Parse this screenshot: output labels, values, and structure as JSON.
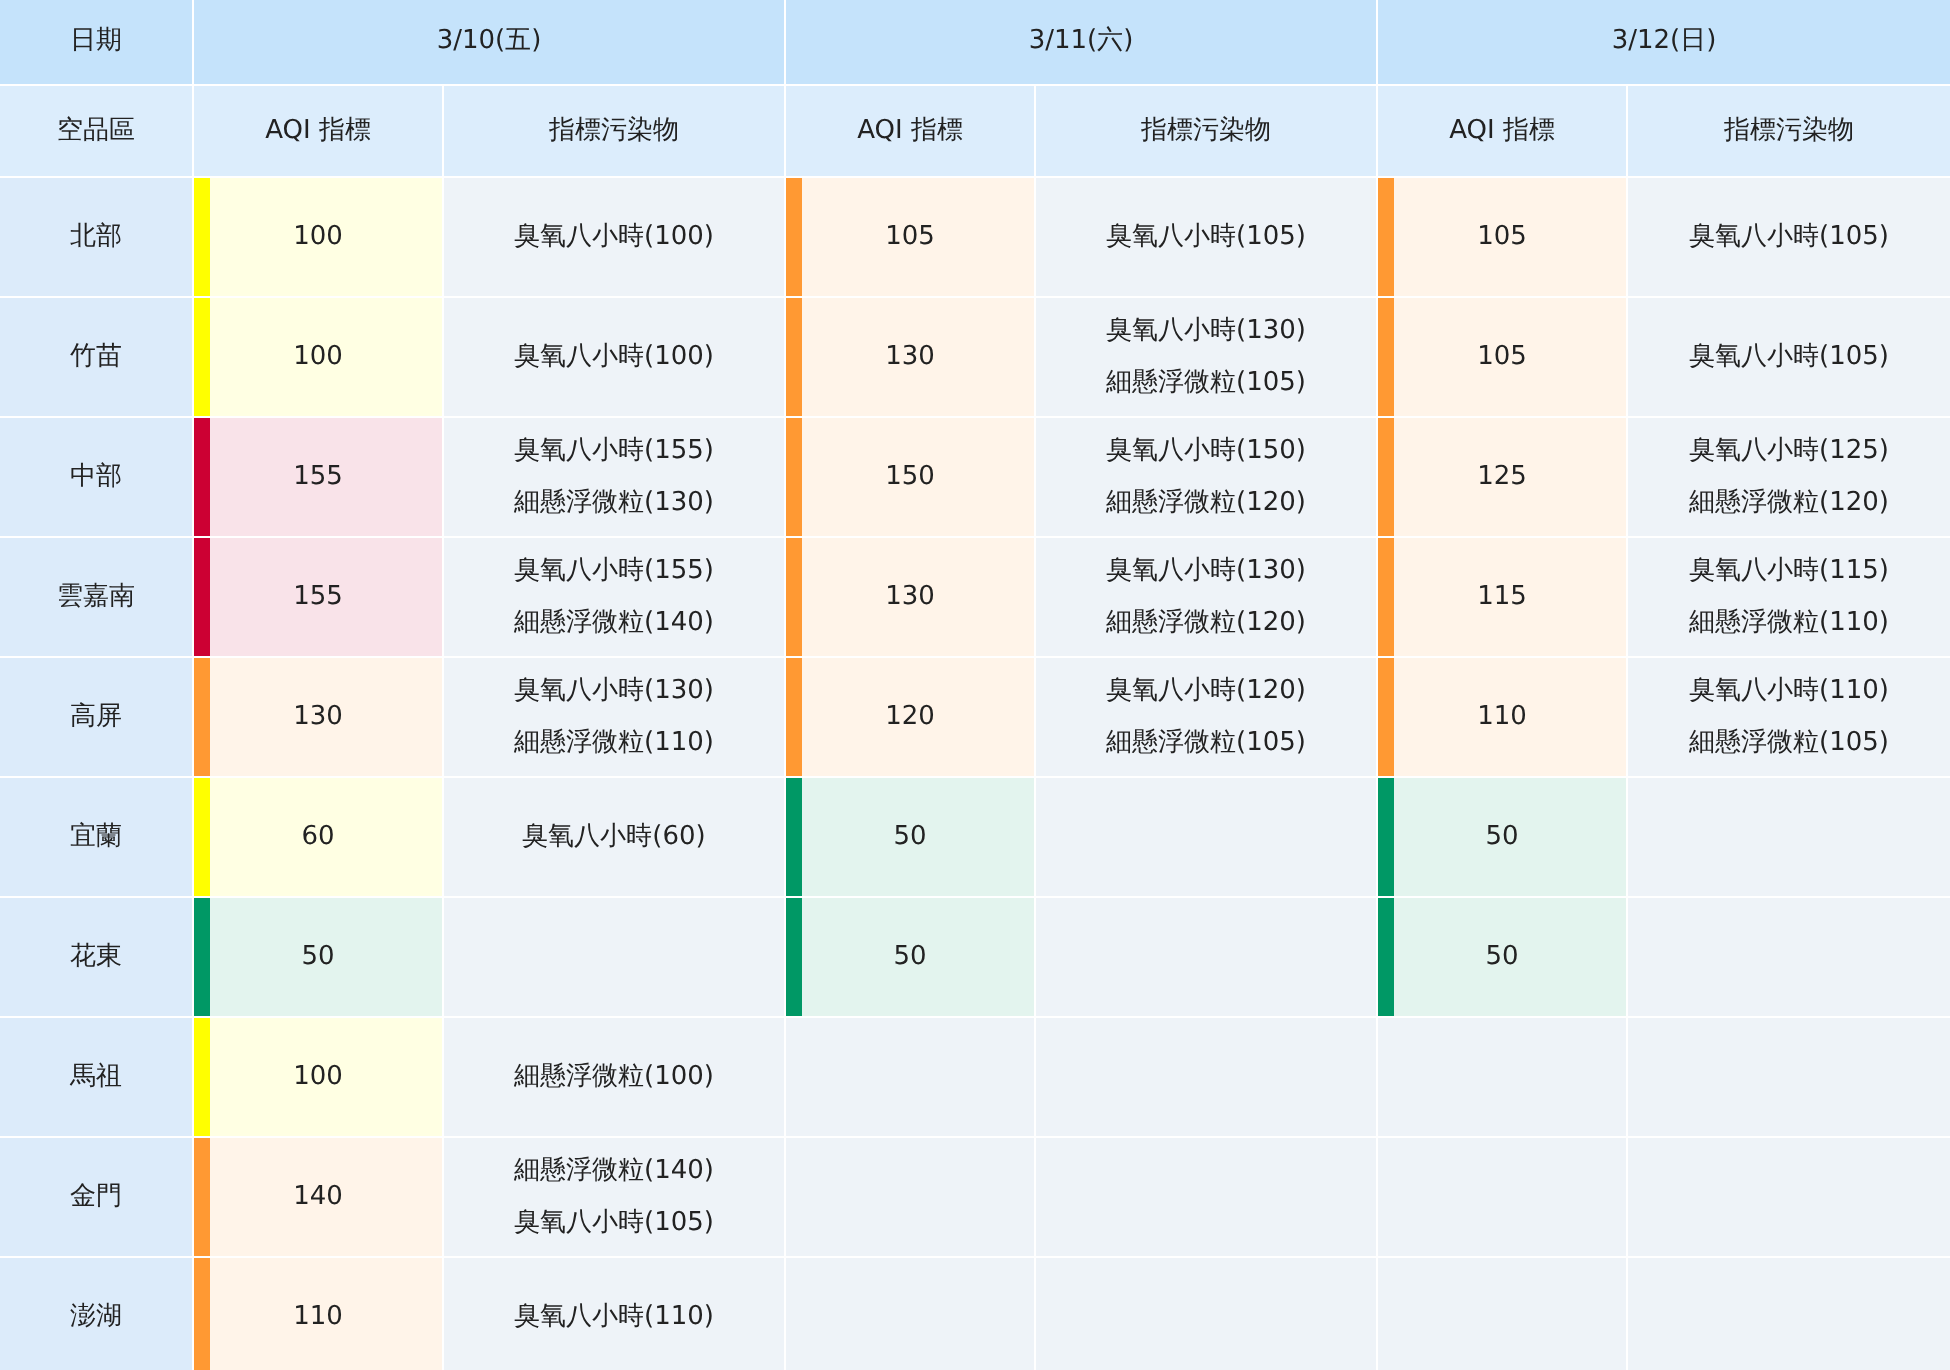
{
  "header": {
    "date_label": "日期",
    "dates": [
      "3/10(五)",
      "3/11(六)",
      "3/12(日)"
    ],
    "region_label": "空品區",
    "subheaders": [
      {
        "aqi_label": "AQI 指標",
        "pollutant_label": "指標污染物"
      },
      {
        "aqi_label": "AQI 指標",
        "pollutant_label": "指標污染物"
      },
      {
        "aqi_label": "AQI 指標",
        "pollutant_label": "指標污染物"
      }
    ]
  },
  "rows": [
    {
      "region": "北部",
      "days": [
        {
          "aqi": "100",
          "color": "#ffff00",
          "pollutants": [
            "臭氧八小時(100)"
          ]
        },
        {
          "aqi": "105",
          "color": "#ff9933",
          "pollutants": [
            "臭氧八小時(105)"
          ]
        },
        {
          "aqi": "105",
          "color": "#ff9933",
          "pollutants": [
            "臭氧八小時(105)"
          ]
        }
      ]
    },
    {
      "region": "竹苗",
      "days": [
        {
          "aqi": "100",
          "color": "#ffff00",
          "pollutants": [
            "臭氧八小時(100)"
          ]
        },
        {
          "aqi": "130",
          "color": "#ff9933",
          "pollutants": [
            "臭氧八小時(130)",
            "細懸浮微粒(105)"
          ]
        },
        {
          "aqi": "105",
          "color": "#ff9933",
          "pollutants": [
            "臭氧八小時(105)"
          ]
        }
      ]
    },
    {
      "region": "中部",
      "days": [
        {
          "aqi": "155",
          "color": "#cc0033",
          "pollutants": [
            "臭氧八小時(155)",
            "細懸浮微粒(130)"
          ]
        },
        {
          "aqi": "150",
          "color": "#ff9933",
          "pollutants": [
            "臭氧八小時(150)",
            "細懸浮微粒(120)"
          ]
        },
        {
          "aqi": "125",
          "color": "#ff9933",
          "pollutants": [
            "臭氧八小時(125)",
            "細懸浮微粒(120)"
          ]
        }
      ]
    },
    {
      "region": "雲嘉南",
      "days": [
        {
          "aqi": "155",
          "color": "#cc0033",
          "pollutants": [
            "臭氧八小時(155)",
            "細懸浮微粒(140)"
          ]
        },
        {
          "aqi": "130",
          "color": "#ff9933",
          "pollutants": [
            "臭氧八小時(130)",
            "細懸浮微粒(120)"
          ]
        },
        {
          "aqi": "115",
          "color": "#ff9933",
          "pollutants": [
            "臭氧八小時(115)",
            "細懸浮微粒(110)"
          ]
        }
      ]
    },
    {
      "region": "高屏",
      "days": [
        {
          "aqi": "130",
          "color": "#ff9933",
          "pollutants": [
            "臭氧八小時(130)",
            "細懸浮微粒(110)"
          ]
        },
        {
          "aqi": "120",
          "color": "#ff9933",
          "pollutants": [
            "臭氧八小時(120)",
            "細懸浮微粒(105)"
          ]
        },
        {
          "aqi": "110",
          "color": "#ff9933",
          "pollutants": [
            "臭氧八小時(110)",
            "細懸浮微粒(105)"
          ]
        }
      ]
    },
    {
      "region": "宜蘭",
      "days": [
        {
          "aqi": "60",
          "color": "#ffff00",
          "pollutants": [
            "臭氧八小時(60)"
          ]
        },
        {
          "aqi": "50",
          "color": "#009865"
        },
        {
          "aqi": "50",
          "color": "#009865"
        }
      ]
    },
    {
      "region": "花東",
      "days": [
        {
          "aqi": "50",
          "color": "#009865"
        },
        {
          "aqi": "50",
          "color": "#009865"
        },
        {
          "aqi": "50",
          "color": "#009865"
        }
      ]
    },
    {
      "region": "馬祖",
      "days": [
        {
          "aqi": "100",
          "color": "#ffff00",
          "pollutants": [
            "細懸浮微粒(100)"
          ]
        }
      ]
    },
    {
      "region": "金門",
      "days": [
        {
          "aqi": "140",
          "color": "#ff9933",
          "pollutants": [
            "細懸浮微粒(140)",
            "臭氧八小時(105)"
          ]
        }
      ]
    },
    {
      "region": "澎湖",
      "days": [
        {
          "aqi": "110",
          "color": "#ff9933",
          "pollutants": [
            "臭氧八小時(110)"
          ]
        }
      ]
    }
  ]
}
